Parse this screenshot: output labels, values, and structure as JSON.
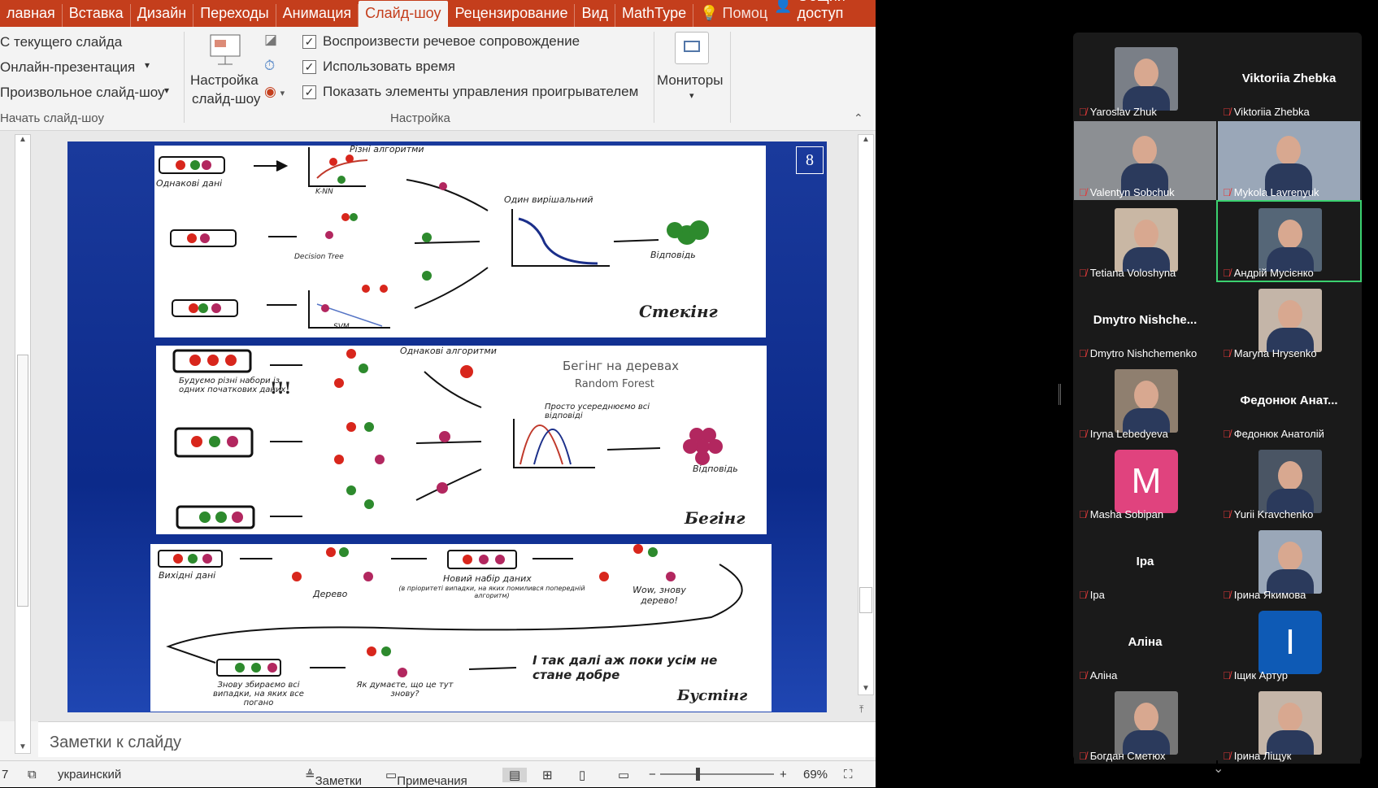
{
  "menu": {
    "tabs": [
      "лавная",
      "Вставка",
      "Дизайн",
      "Переходы",
      "Анимация",
      "Слайд-шоу",
      "Рецензирование",
      "Вид",
      "MathType"
    ],
    "help": "Помоц",
    "share": "Общий доступ"
  },
  "ribbon": {
    "start_from_current": "С текущего слайда",
    "online": "Онлайн-презентация",
    "custom": "Произвольное слайд-шоу",
    "group_start": "Начать слайд-шоу",
    "setup_label_1": "Настройка",
    "setup_label_2": "слайд-шоу",
    "cb_narration": "Воспроизвести речевое сопровождение",
    "cb_timing": "Использовать время",
    "cb_controls": "Показать элементы управления проигрывателем",
    "group_setup": "Настройка",
    "monitors": "Мониторы"
  },
  "slide": {
    "number": "8",
    "p1": {
      "same_data": "Однакові дані",
      "algs": "Різні алгоритми",
      "knn": "K-NN",
      "dtree": "Decision Tree",
      "svm": "SVM",
      "decider": "Один вирішальний",
      "answer": "Відповідь",
      "title": "Стекінг"
    },
    "p2": {
      "same_algs": "Однакові алгоритми",
      "build": "Будуємо різні набори із одних початкових даних",
      "excl": "!!!",
      "rf1": "Бегінг на деревах",
      "rf2": "Random Forest",
      "avg": "Просто усереднюємо всі відповіді",
      "answer": "Відповідь",
      "title": "Бегінг"
    },
    "p3": {
      "input": "Вихідні дані",
      "tree": "Дерево",
      "newset": "Новий набір даних",
      "newset_note": "(в пріоритеті випадки, на яких помилився попередній алгоритм)",
      "wow": "Wow, знову дерево!",
      "again": "Знову збираємо всі випадки, на яких все погано",
      "guess": "Як думаєте, що це тут знову?",
      "until": "І так далі аж поки усім не стане добре",
      "title": "Бустінг"
    }
  },
  "notes_placeholder": "Заметки к слайду",
  "status": {
    "slide": "7",
    "lang": "украинский",
    "notes": "Заметки",
    "comments": "Примечания",
    "zoom": "69%"
  },
  "participants": [
    {
      "name": "Yaroslav Zhuk",
      "video": true
    },
    {
      "name": "Viktoriia Zhebka",
      "video": false,
      "center": "Viktoriia Zhebka"
    },
    {
      "name": "Valentyn Sobchuk",
      "video": true
    },
    {
      "name": "Mykola Lavrenyuk",
      "video": true
    },
    {
      "name": "Tetiana Voloshyna",
      "video": true
    },
    {
      "name": "Андрій Мусієнко",
      "video": true,
      "active": true
    },
    {
      "name": "Dmytro Nishchemenko",
      "video": false,
      "center": "Dmytro  Nishche..."
    },
    {
      "name": "Maryna Hrysenko",
      "video": true
    },
    {
      "name": "Iryna Lebedyeva",
      "video": true
    },
    {
      "name": "Федонюк Анатолій",
      "video": false,
      "center": "Федонюк  Анат..."
    },
    {
      "name": "Masha Sobipan",
      "video": false,
      "avatar": "M",
      "avatar_color": "#e0437e"
    },
    {
      "name": "Yurii Kravchenko",
      "video": true
    },
    {
      "name": "Ipa",
      "video": false,
      "center": "Ipa"
    },
    {
      "name": "Ірина Якимова",
      "video": true
    },
    {
      "name": "Аліна",
      "video": false,
      "center": "Аліна"
    },
    {
      "name": "Іщик Артур",
      "video": false,
      "avatar": "I",
      "avatar_color": "#0e5ab5"
    },
    {
      "name": "Богдан Сметюх",
      "video": true
    },
    {
      "name": "Ірина Ліщук",
      "video": true
    }
  ]
}
